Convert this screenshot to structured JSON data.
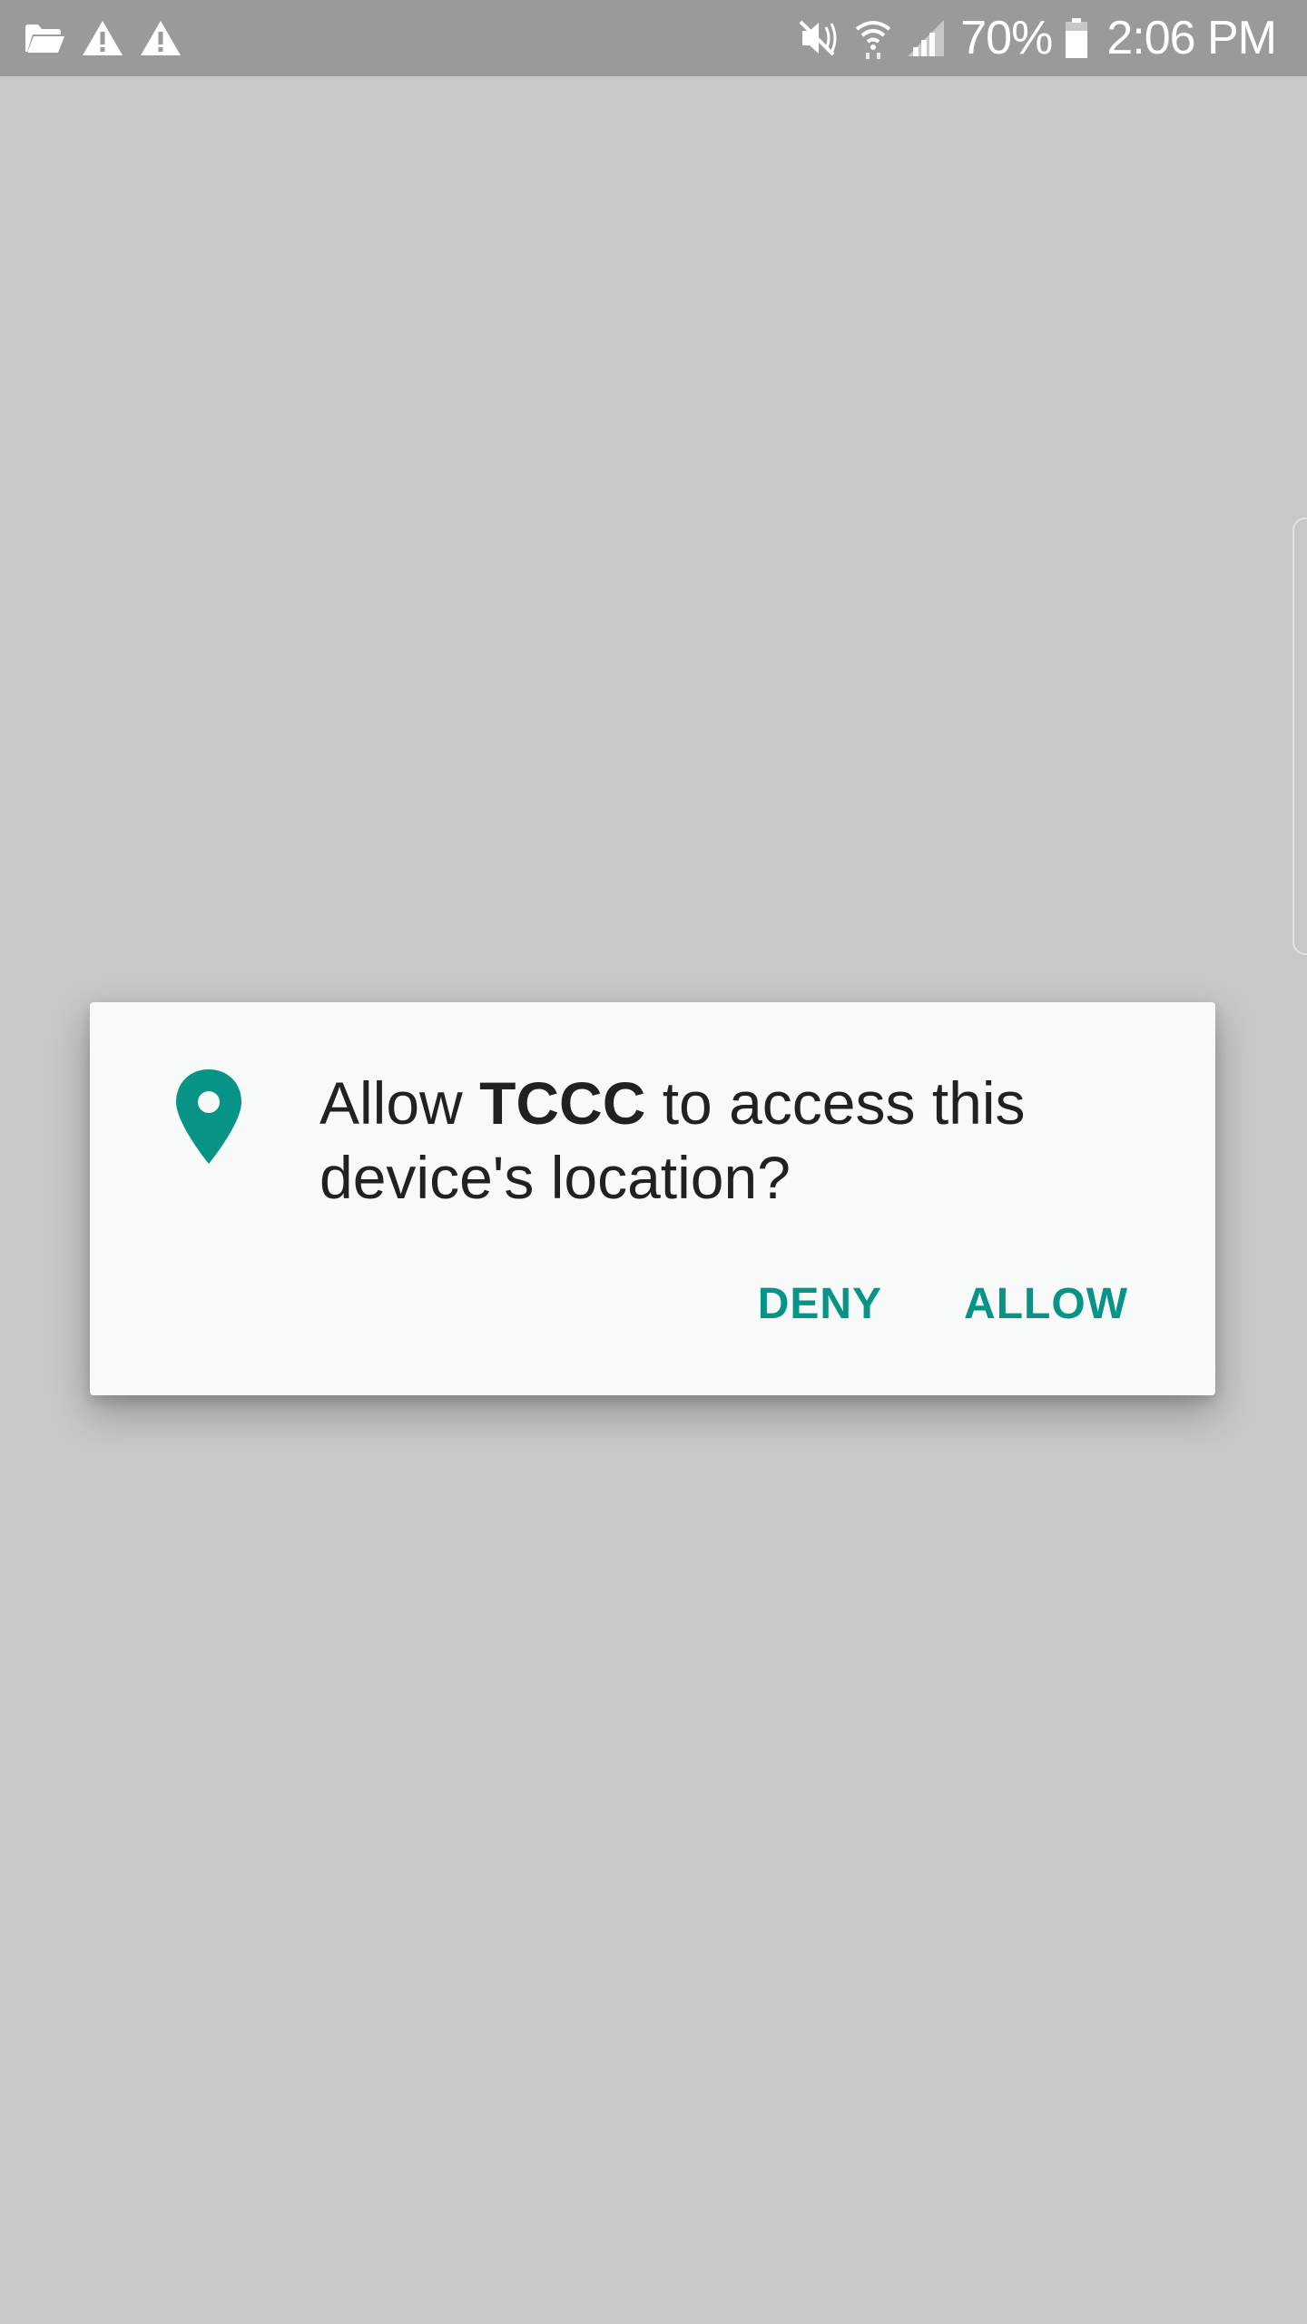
{
  "status_bar": {
    "left_icons": [
      "folder-icon",
      "warning-icon",
      "warning-icon"
    ],
    "right_icons": [
      "mute-icon",
      "wifi-icon",
      "signal-icon",
      "battery-icon"
    ],
    "battery_percent": "70%",
    "time": "2:06 PM"
  },
  "dialog": {
    "icon": "location-pin-icon",
    "message_prefix": "Allow ",
    "app_name": "TCCC",
    "message_suffix": " to access this device's location?",
    "deny_label": "DENY",
    "allow_label": "ALLOW"
  },
  "colors": {
    "accent": "#079486",
    "scrim_background": "#c8c8c8",
    "status_bar": "#9a9a9a",
    "dialog_background": "#f8f9f9",
    "text": "#212121"
  }
}
